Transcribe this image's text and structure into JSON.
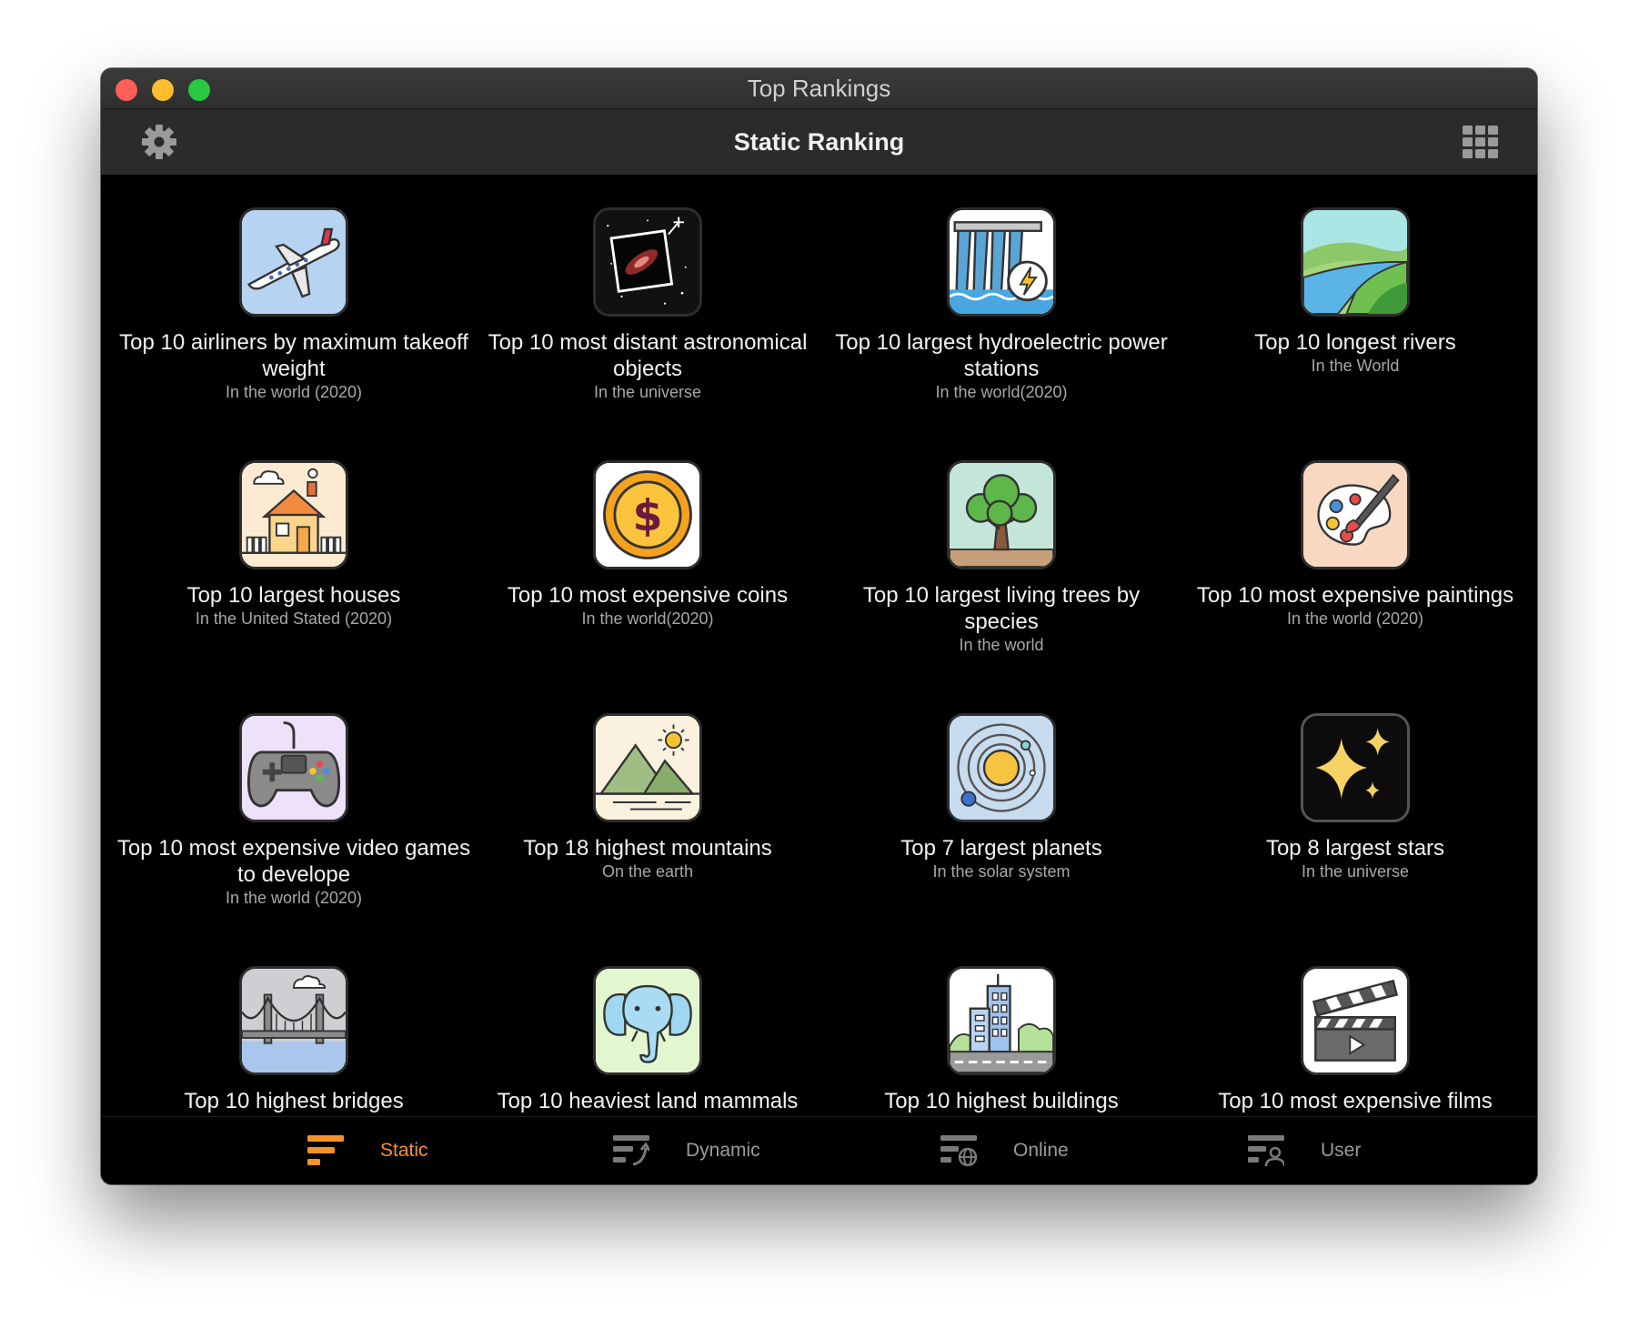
{
  "window": {
    "title": "Top Rankings"
  },
  "toolbar": {
    "title": "Static Ranking",
    "left_icon": "gear-icon",
    "right_icon": "grid-icon"
  },
  "cards": [
    {
      "title": "Top 10 airliners by maximum takeoff weight",
      "subtitle": "In the world (2020)",
      "icon": "airplane-icon"
    },
    {
      "title": "Top 10 most distant astronomical objects",
      "subtitle": "In the universe",
      "icon": "galaxy-icon"
    },
    {
      "title": "Top 10 largest hydroelectric power stations",
      "subtitle": "In the world(2020)",
      "icon": "dam-icon"
    },
    {
      "title": "Top 10 longest rivers",
      "subtitle": "In the World",
      "icon": "river-icon"
    },
    {
      "title": "Top 10 largest houses",
      "subtitle": "In the United Stated (2020)",
      "icon": "house-icon"
    },
    {
      "title": "Top 10 most expensive coins",
      "subtitle": "In the world(2020)",
      "icon": "coin-icon"
    },
    {
      "title": "Top 10 largest living trees by species",
      "subtitle": "In the world",
      "icon": "tree-icon"
    },
    {
      "title": "Top 10 most expensive paintings",
      "subtitle": "In the world (2020)",
      "icon": "palette-icon"
    },
    {
      "title": "Top 10 most expensive video games to develope",
      "subtitle": "In the world (2020)",
      "icon": "gamepad-icon"
    },
    {
      "title": "Top 18 highest mountains",
      "subtitle": "On the earth",
      "icon": "mountain-icon"
    },
    {
      "title": "Top 7 largest planets",
      "subtitle": "In the solar system",
      "icon": "planet-icon"
    },
    {
      "title": "Top 8 largest stars",
      "subtitle": "In the universe",
      "icon": "stars-icon"
    },
    {
      "title": "Top 10 highest bridges",
      "subtitle": "",
      "icon": "bridge-icon"
    },
    {
      "title": "Top 10 heaviest land mammals",
      "subtitle": "",
      "icon": "elephant-icon"
    },
    {
      "title": "Top 10 highest buildings",
      "subtitle": "",
      "icon": "building-icon"
    },
    {
      "title": "Top 10 most expensive films",
      "subtitle": "",
      "icon": "clapperboard-icon"
    }
  ],
  "tabs": [
    {
      "label": "Static",
      "icon": "static-ranking-icon",
      "active": true
    },
    {
      "label": "Dynamic",
      "icon": "dynamic-ranking-icon",
      "active": false
    },
    {
      "label": "Online",
      "icon": "online-ranking-icon",
      "active": false
    },
    {
      "label": "User",
      "icon": "user-ranking-icon",
      "active": false
    }
  ],
  "colors": {
    "accent": "#f5922a",
    "background": "#000000",
    "toolbar": "#2b2b2b"
  }
}
